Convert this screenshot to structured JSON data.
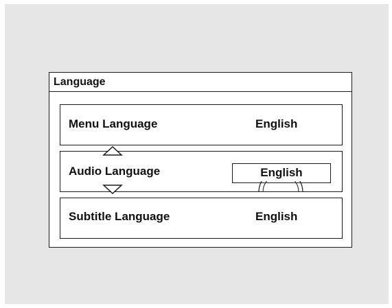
{
  "panel": {
    "title": "Language",
    "rows": [
      {
        "label": "Menu Language",
        "value": "English"
      },
      {
        "label": "Audio Language",
        "value": "English",
        "selected": true
      },
      {
        "label": "Subtitle Language",
        "value": "English"
      }
    ]
  },
  "icons": {
    "scroll_up": "triangle-up-outline-icon",
    "scroll_down": "triangle-down-outline-icon",
    "dial": "rotary-dial-icon"
  },
  "colors": {
    "background": "#e6e6e7",
    "panel": "#ffffff",
    "line": "#1a1a1a"
  }
}
